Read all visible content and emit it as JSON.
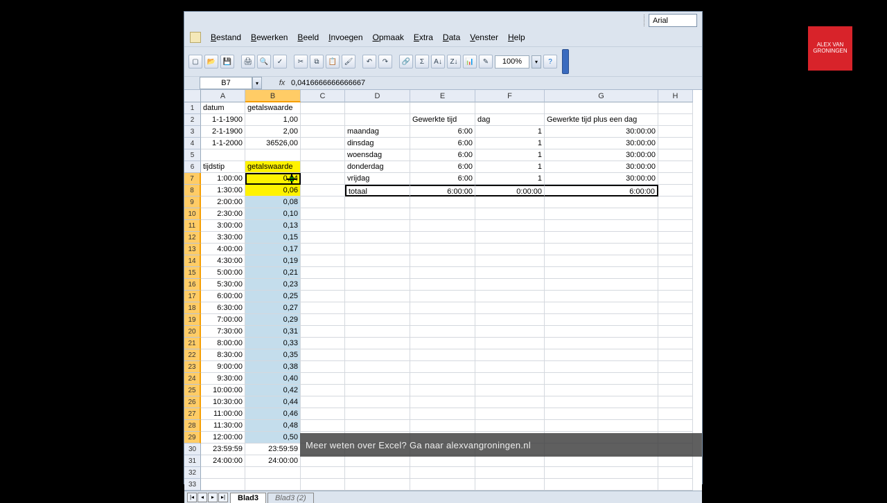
{
  "font_name": "Arial",
  "menu": [
    "Bestand",
    "Bewerken",
    "Beeld",
    "Invoegen",
    "Opmaak",
    "Extra",
    "Data",
    "Venster",
    "Help"
  ],
  "zoom": "100%",
  "name_box": "B7",
  "formula": "0,0416666666666667",
  "columns": [
    "A",
    "B",
    "C",
    "D",
    "E",
    "F",
    "G",
    "H"
  ],
  "col_widths": [
    "wA",
    "wB",
    "wC",
    "wD",
    "wE",
    "wF",
    "wG",
    "wH"
  ],
  "rows": [
    {
      "n": 1,
      "A": "datum",
      "B": "getalswaarde"
    },
    {
      "n": 2,
      "A": "1-1-1900",
      "B": "1,00",
      "E": "Gewerkte tijd",
      "F": "dag",
      "G": "Gewerkte tijd plus een dag"
    },
    {
      "n": 3,
      "A": "2-1-1900",
      "B": "2,00",
      "D": "maandag",
      "E": "6:00",
      "F": "1",
      "G": "30:00:00"
    },
    {
      "n": 4,
      "A": "1-1-2000",
      "B": "36526,00",
      "D": "dinsdag",
      "E": "6:00",
      "F": "1",
      "G": "30:00:00"
    },
    {
      "n": 5,
      "D": "woensdag",
      "E": "6:00",
      "F": "1",
      "G": "30:00:00"
    },
    {
      "n": 6,
      "A": "tijdstip",
      "B": "getalswaarde",
      "D": "donderdag",
      "E": "6:00",
      "F": "1",
      "G": "30:00:00"
    },
    {
      "n": 7,
      "A": "1:00:00",
      "B": "0,04",
      "D": "vrijdag",
      "E": "6:00",
      "F": "1",
      "G": "30:00:00"
    },
    {
      "n": 8,
      "A": "1:30:00",
      "B": "0,06",
      "D": "totaal",
      "E": "6:00:00",
      "F": "0:00:00",
      "G": "6:00:00"
    },
    {
      "n": 9,
      "A": "2:00:00",
      "B": "0,08"
    },
    {
      "n": 10,
      "A": "2:30:00",
      "B": "0,10"
    },
    {
      "n": 11,
      "A": "3:00:00",
      "B": "0,13"
    },
    {
      "n": 12,
      "A": "3:30:00",
      "B": "0,15"
    },
    {
      "n": 13,
      "A": "4:00:00",
      "B": "0,17"
    },
    {
      "n": 14,
      "A": "4:30:00",
      "B": "0,19"
    },
    {
      "n": 15,
      "A": "5:00:00",
      "B": "0,21"
    },
    {
      "n": 16,
      "A": "5:30:00",
      "B": "0,23"
    },
    {
      "n": 17,
      "A": "6:00:00",
      "B": "0,25"
    },
    {
      "n": 18,
      "A": "6:30:00",
      "B": "0,27"
    },
    {
      "n": 19,
      "A": "7:00:00",
      "B": "0,29"
    },
    {
      "n": 20,
      "A": "7:30:00",
      "B": "0,31"
    },
    {
      "n": 21,
      "A": "8:00:00",
      "B": "0,33"
    },
    {
      "n": 22,
      "A": "8:30:00",
      "B": "0,35"
    },
    {
      "n": 23,
      "A": "9:00:00",
      "B": "0,38"
    },
    {
      "n": 24,
      "A": "9:30:00",
      "B": "0,40"
    },
    {
      "n": 25,
      "A": "10:00:00",
      "B": "0,42"
    },
    {
      "n": 26,
      "A": "10:30:00",
      "B": "0,44"
    },
    {
      "n": 27,
      "A": "11:00:00",
      "B": "0,46"
    },
    {
      "n": 28,
      "A": "11:30:00",
      "B": "0,48"
    },
    {
      "n": 29,
      "A": "12:00:00",
      "B": "0,50"
    },
    {
      "n": 30,
      "A": "23:59:59",
      "B": "23:59:59"
    },
    {
      "n": 31,
      "A": "24:00:00",
      "B": "24:00:00"
    },
    {
      "n": 32
    },
    {
      "n": 33
    }
  ],
  "selected_row_start": 7,
  "selected_row_end": 29,
  "banner": "Meer weten over Excel? Ga naar alexvangroningen.nl",
  "logo_line1": "ALEX VAN",
  "logo_line2": "GRONINGEN",
  "tabs": {
    "active": "Blad3",
    "inactive": "Blad3 (2)"
  },
  "toolbar_icons": [
    "new",
    "open",
    "save",
    "print",
    "preview",
    "spell",
    "cut",
    "copy",
    "paste",
    "fmt",
    "undo",
    "redo",
    "link",
    "sum",
    "sort-asc",
    "sort-desc",
    "chart",
    "draw"
  ],
  "right_align_cols": {
    "A": [
      2,
      3,
      4,
      7,
      8,
      9,
      10,
      11,
      12,
      13,
      14,
      15,
      16,
      17,
      18,
      19,
      20,
      21,
      22,
      23,
      24,
      25,
      26,
      27,
      28,
      29,
      30,
      31
    ],
    "B": [
      2,
      3,
      4,
      7,
      8,
      9,
      10,
      11,
      12,
      13,
      14,
      15,
      16,
      17,
      18,
      19,
      20,
      21,
      22,
      23,
      24,
      25,
      26,
      27,
      28,
      29,
      30,
      31
    ],
    "E": [
      3,
      4,
      5,
      6,
      7,
      8
    ],
    "F": [
      3,
      4,
      5,
      6,
      7,
      8
    ],
    "G": [
      3,
      4,
      5,
      6,
      7,
      8
    ]
  }
}
